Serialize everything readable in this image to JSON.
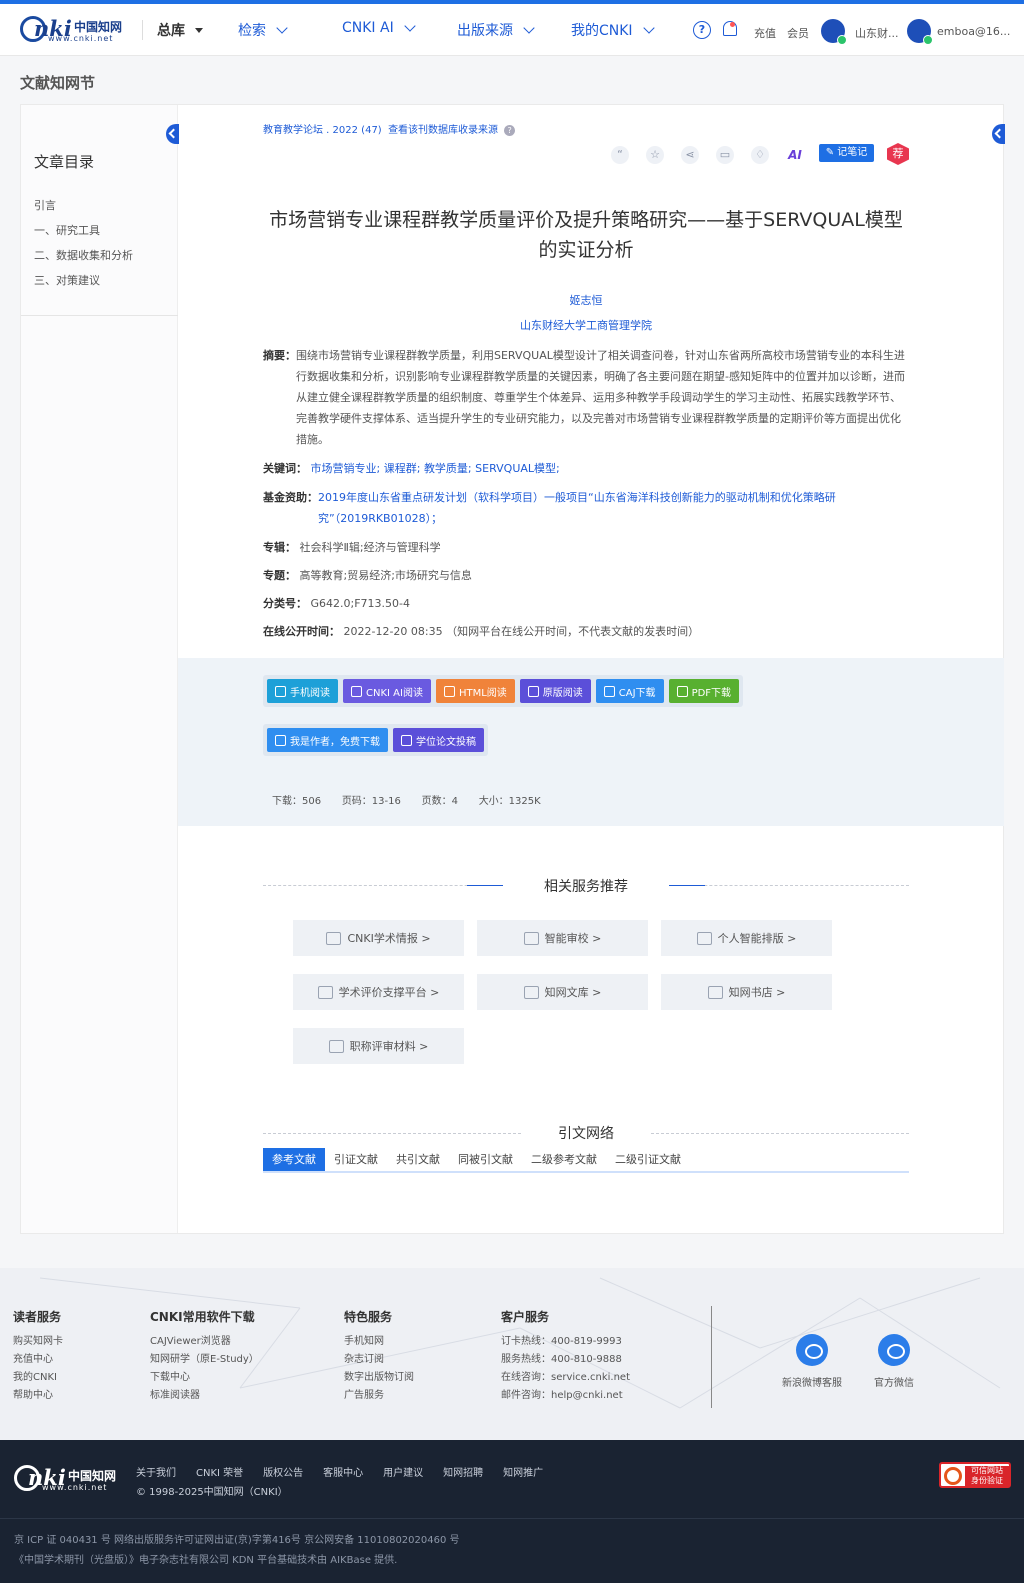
{
  "header": {
    "logo_cn": "中国知网",
    "logo_url": "www.cnki.net",
    "nav": [
      "总库",
      "检索",
      "CNKI AI",
      "出版来源",
      "我的CNKI"
    ],
    "recharge": "充值",
    "member": "会员",
    "org_user": "山东财...",
    "user": "emboa@16..."
  },
  "page_title": "文献知网节",
  "sidebar": {
    "title": "文章目录",
    "items": [
      "引言",
      "一、研究工具",
      "二、数据收集和分析",
      "三、对策建议"
    ]
  },
  "article": {
    "source_journal": "教育教学论坛",
    "source_issue": "2022 (47)",
    "source_link": "查看该刊数据库收录来源",
    "note_button": "记笔记",
    "rec_badge": "荐",
    "ai_tool": "AI",
    "title": "市场营销专业课程群教学质量评价及提升策略研究——基于SERVQUAL模型的实证分析",
    "author": "姬志恒",
    "organization": "山东财经大学工商管理学院",
    "abstract_label": "摘要：",
    "abstract": "围绕市场营销专业课程群教学质量，利用SERVQUAL模型设计了相关调查问卷，针对山东省两所高校市场营销专业的本科生进行数据收集和分析，识别影响专业课程群教学质量的关键因素，明确了各主要问题在期望-感知矩阵中的位置并加以诊断，进而从建立健全课程群教学质量的组织制度、尊重学生个体差异、运用多种教学手段调动学生的学习主动性、拓展实践教学环节、完善教学硬件支撑体系、适当提升学生的专业研究能力，以及完善对市场营销专业课程群教学质量的定期评价等方面提出优化措施。",
    "keywords_label": "关键词：",
    "keywords": [
      "市场营销专业;",
      "课程群;",
      "教学质量;",
      "SERVQUAL模型;"
    ],
    "fund_label": "基金资助：",
    "fund": "2019年度山东省重点研发计划（软科学项目）一般项目“山东省海洋科技创新能力的驱动机制和优化策略研究”（2019RKB01028）；",
    "series_label": "专辑：",
    "series": "社会科学Ⅱ辑;经济与管理科学",
    "topic_label": "专题：",
    "topic": "高等教育;贸易经济;市场研究与信息",
    "class_label": "分类号：",
    "class_no": "G642.0;F713.50-4",
    "pubtime_label": "在线公开时间：",
    "pubtime": "2022-12-20 08:35",
    "pubtime_note": "（知网平台在线公开时间，不代表文献的发表时间）"
  },
  "downloads": {
    "row1": [
      {
        "label": "手机阅读",
        "color": "#1da0d8"
      },
      {
        "label": "CNKI AI阅读",
        "color": "#6a5ae0"
      },
      {
        "label": "HTML阅读",
        "color": "#f0833a"
      },
      {
        "label": "原版阅读",
        "color": "#5b4fd9"
      },
      {
        "label": "CAJ下载",
        "color": "#2f8ef0"
      },
      {
        "label": "PDF下载",
        "color": "#58b030"
      }
    ],
    "row2": [
      {
        "label": "我是作者，免费下载",
        "color": "#2f8ef0"
      },
      {
        "label": "学位论文投稿",
        "color": "#5b4fd9"
      }
    ],
    "stats": {
      "downloads": "下载：506",
      "pages_range": "页码：13-16",
      "page_count": "页数：4",
      "size": "大小：1325K"
    }
  },
  "services": {
    "title": "相关服务推荐",
    "items": [
      "CNKI学术情报 >",
      "智能审校 >",
      "个人智能排版 >",
      "学术评价支撑平台 >",
      "知网文库 >",
      "知网书店 >",
      "职称评审材料 >"
    ]
  },
  "citation": {
    "title": "引文网络",
    "tabs": [
      "参考文献",
      "引证文献",
      "共引文献",
      "同被引文献",
      "二级参考文献",
      "二级引证文献"
    ]
  },
  "footer": {
    "cols": [
      {
        "title": "读者服务",
        "items": [
          "购买知网卡",
          "充值中心",
          "我的CNKI",
          "帮助中心"
        ]
      },
      {
        "title": "CNKI常用软件下载",
        "items": [
          "CAJViewer浏览器",
          "知网研学（原E-Study）",
          "下载中心",
          "标准阅读器"
        ]
      },
      {
        "title": "特色服务",
        "items": [
          "手机知网",
          "杂志订阅",
          "数字出版物订阅",
          "广告服务"
        ]
      },
      {
        "title": "客户服务",
        "items": [
          "订卡热线：400-819-9993",
          "服务热线：400-810-9888",
          "在线咨询：service.cnki.net",
          "邮件咨询：help@cnki.net"
        ]
      }
    ],
    "weibo": "新浪微博客服",
    "wechat": "官方微信",
    "links": [
      "关于我们",
      "CNKI 荣誉",
      "版权公告",
      "客服中心",
      "用户建议",
      "知网招聘",
      "知网推广"
    ],
    "copyright": "© 1998-2025中国知网（CNKI）",
    "icp1": "京 ICP 证 040431 号  网络出版服务许可证网出证(京)字第416号  京公网安备 11010802020460 号",
    "icp2": "《中国学术期刊（光盘版）》电子杂志社有限公司  KDN 平台基础技术由 AIKBase 提供.",
    "trust_title": "可信网站",
    "trust_sub": "身份验证"
  }
}
